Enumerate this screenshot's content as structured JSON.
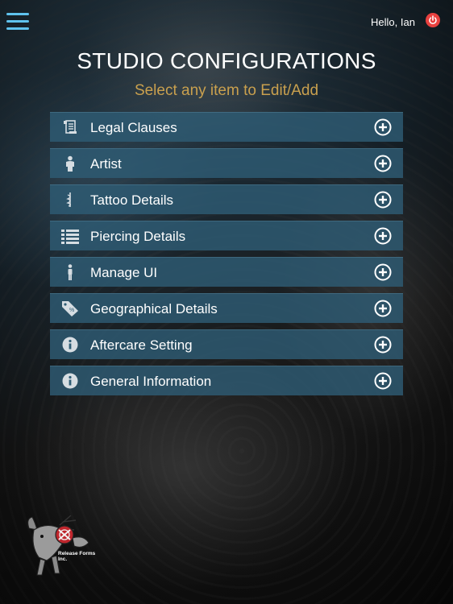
{
  "header": {
    "greeting": "Hello, Ian"
  },
  "page": {
    "title": "STUDIO CONFIGURATIONS",
    "subtitle": "Select any item to Edit/Add"
  },
  "menu": {
    "items": [
      {
        "label": "Legal Clauses",
        "icon": "scroll-icon"
      },
      {
        "label": "Artist",
        "icon": "person-icon"
      },
      {
        "label": "Tattoo Details",
        "icon": "tattoo-icon"
      },
      {
        "label": "Piercing Details",
        "icon": "list-icon"
      },
      {
        "label": "Manage UI",
        "icon": "figure-icon"
      },
      {
        "label": "Geographical Details",
        "icon": "tag-icon"
      },
      {
        "label": "Aftercare Setting",
        "icon": "info-icon"
      },
      {
        "label": "General Information",
        "icon": "info-icon"
      }
    ]
  },
  "logo": {
    "text": "Release Forms Inc."
  },
  "colors": {
    "accent": "#5fc3ee",
    "subtitle": "#c9a04e",
    "power": "#e8413f",
    "row": "#2e5c74"
  }
}
